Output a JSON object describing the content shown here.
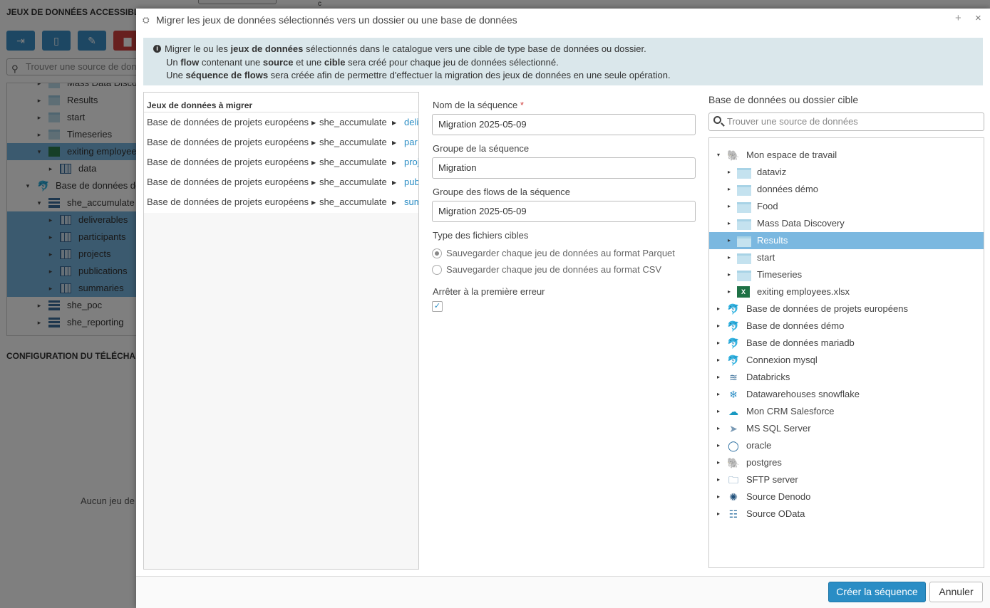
{
  "background": {
    "panel_title": "JEUX DE DONNÉES ACCESSIBLES",
    "search_placeholder": "Trouver une source de donn",
    "tree": [
      {
        "label": "Mass Data Discovery",
        "indent": 1,
        "icon": "folder",
        "selected": false,
        "toggle": "▸"
      },
      {
        "label": "Results",
        "indent": 1,
        "icon": "folder",
        "selected": false,
        "toggle": "▸"
      },
      {
        "label": "start",
        "indent": 1,
        "icon": "folder",
        "selected": false,
        "toggle": "▸"
      },
      {
        "label": "Timeseries",
        "indent": 1,
        "icon": "folder",
        "selected": false,
        "toggle": "▸"
      },
      {
        "label": "exiting employees.x",
        "indent": 1,
        "icon": "xls",
        "selected": true,
        "toggle": "▾"
      },
      {
        "label": "data",
        "indent": 2,
        "icon": "tbl",
        "selected": false,
        "toggle": "▸"
      },
      {
        "label": "Base de données de p",
        "indent": 0,
        "icon": "dolph",
        "selected": false,
        "toggle": "▾"
      },
      {
        "label": "she_accumulate",
        "indent": 1,
        "icon": "db",
        "selected": false,
        "toggle": "▾"
      },
      {
        "label": "deliverables",
        "indent": 2,
        "icon": "tbl",
        "selected": true,
        "toggle": "▸"
      },
      {
        "label": "participants",
        "indent": 2,
        "icon": "tbl",
        "selected": true,
        "toggle": "▸"
      },
      {
        "label": "projects",
        "indent": 2,
        "icon": "tbl",
        "selected": true,
        "toggle": "▸"
      },
      {
        "label": "publications",
        "indent": 2,
        "icon": "tbl",
        "selected": true,
        "toggle": "▸"
      },
      {
        "label": "summaries",
        "indent": 2,
        "icon": "tbl",
        "selected": true,
        "toggle": "▸"
      },
      {
        "label": "she_poc",
        "indent": 1,
        "icon": "db",
        "selected": false,
        "toggle": "▸"
      },
      {
        "label": "she_reporting",
        "indent": 1,
        "icon": "db",
        "selected": false,
        "toggle": "▸"
      }
    ],
    "section_title": "CONFIGURATION DU TÉLÉCHARG",
    "empty_text": "Aucun jeu de",
    "tab2_label": "c"
  },
  "modal": {
    "title": "Migrer les jeux de données sélectionnés vers un dossier ou une base de données",
    "max_glyph": "+",
    "close_glyph": "×",
    "info": {
      "l1_a": "Migrer le ou les ",
      "l1_b": "jeux de données",
      "l1_c": " sélectionnés dans le catalogue vers une cible de type base de données ou dossier.",
      "l2_a": "Un ",
      "l2_b": "flow",
      "l2_c": " contenant une ",
      "l2_d": "source",
      "l2_e": " et une ",
      "l2_f": "cible",
      "l2_g": " sera créé pour chaque jeu de données sélectionné.",
      "l3_a": "Une ",
      "l3_b": "séquence de flows",
      "l3_c": " sera créée afin de permettre d'effectuer la migration des jeux de données en une seule opération."
    },
    "datasets": {
      "header": "Jeux de données à migrer",
      "rows": [
        {
          "db": "Base de données de projets européens",
          "schema": "she_accumulate",
          "table": "deli"
        },
        {
          "db": "Base de données de projets européens",
          "schema": "she_accumulate",
          "table": "par"
        },
        {
          "db": "Base de données de projets européens",
          "schema": "she_accumulate",
          "table": "proj"
        },
        {
          "db": "Base de données de projets européens",
          "schema": "she_accumulate",
          "table": "pub"
        },
        {
          "db": "Base de données de projets européens",
          "schema": "she_accumulate",
          "table": "sum"
        }
      ]
    },
    "form": {
      "seq_name_label": "Nom de la séquence",
      "required_mark": "*",
      "seq_name_value": "Migration 2025-05-09",
      "seq_group_label": "Groupe de la séquence",
      "seq_group_value": "Migration",
      "flows_group_label": "Groupe des flows de la séquence",
      "flows_group_value": "Migration 2025-05-09",
      "file_type_label": "Type des fichiers cibles",
      "radio_parquet": "Sauvegarder chaque jeu de données au format Parquet",
      "radio_csv": "Sauvegarder chaque jeu de données au format CSV",
      "selected_format": "Parquet",
      "stop_label": "Arrêter à la première erreur",
      "stop_checked": true
    },
    "target": {
      "label": "Base de données ou dossier cible",
      "search_placeholder": "Trouver une source de données",
      "tree": [
        {
          "label": "Mon espace de travail",
          "indent": 0,
          "icon": "🐘",
          "name": "workspace-icon",
          "toggle": "▾",
          "selected": false,
          "color": "#5a8fb5"
        },
        {
          "label": "dataviz",
          "indent": 1,
          "icon": "folder",
          "name": "folder-icon",
          "toggle": "▸",
          "selected": false
        },
        {
          "label": "données démo",
          "indent": 1,
          "icon": "folder",
          "name": "folder-icon",
          "toggle": "▸",
          "selected": false
        },
        {
          "label": "Food",
          "indent": 1,
          "icon": "folder",
          "name": "folder-icon",
          "toggle": "▸",
          "selected": false
        },
        {
          "label": "Mass Data Discovery",
          "indent": 1,
          "icon": "folder",
          "name": "folder-icon",
          "toggle": "▸",
          "selected": false
        },
        {
          "label": "Results",
          "indent": 1,
          "icon": "folder",
          "name": "folder-icon",
          "toggle": "▸",
          "selected": true
        },
        {
          "label": "start",
          "indent": 1,
          "icon": "folder",
          "name": "folder-icon",
          "toggle": "▸",
          "selected": false
        },
        {
          "label": "Timeseries",
          "indent": 1,
          "icon": "folder",
          "name": "folder-icon",
          "toggle": "▸",
          "selected": false
        },
        {
          "label": "exiting employees.xlsx",
          "indent": 1,
          "icon": "xls",
          "name": "excel-icon",
          "toggle": "▸",
          "selected": false
        },
        {
          "label": "Base de données de projets européens",
          "indent": 0,
          "icon": "🐬",
          "name": "mysql-dolphin-icon",
          "toggle": "▸",
          "selected": false,
          "color": "#2b6ea3"
        },
        {
          "label": "Base de données démo",
          "indent": 0,
          "icon": "🐬",
          "name": "mysql-dolphin-icon",
          "toggle": "▸",
          "selected": false,
          "color": "#2b6ea3"
        },
        {
          "label": "Base de données mariadb",
          "indent": 0,
          "icon": "🐬",
          "name": "mariadb-icon",
          "toggle": "▸",
          "selected": false,
          "color": "#2b6ea3"
        },
        {
          "label": "Connexion mysql",
          "indent": 0,
          "icon": "🐬",
          "name": "mysql-icon",
          "toggle": "▸",
          "selected": false,
          "color": "#999999"
        },
        {
          "label": "Databricks",
          "indent": 0,
          "icon": "≋",
          "name": "databricks-icon",
          "toggle": "▸",
          "selected": false,
          "color": "#3a6f99"
        },
        {
          "label": "Datawarehouses snowflake",
          "indent": 0,
          "icon": "❄",
          "name": "snowflake-icon",
          "toggle": "▸",
          "selected": false,
          "color": "#2a8dc5"
        },
        {
          "label": "Mon CRM Salesforce",
          "indent": 0,
          "icon": "☁",
          "name": "salesforce-icon",
          "toggle": "▸",
          "selected": false,
          "color": "#1798c1"
        },
        {
          "label": "MS SQL Server",
          "indent": 0,
          "icon": "➤",
          "name": "sql-server-icon",
          "toggle": "▸",
          "selected": false,
          "color": "#7a9ab5"
        },
        {
          "label": "oracle",
          "indent": 0,
          "icon": "◯",
          "name": "oracle-icon",
          "toggle": "▸",
          "selected": false,
          "color": "#2a6ea0"
        },
        {
          "label": "postgres",
          "indent": 0,
          "icon": "🐘",
          "name": "postgres-icon",
          "toggle": "▸",
          "selected": false,
          "color": "#336791"
        },
        {
          "label": "SFTP server",
          "indent": 0,
          "icon": "🗀",
          "name": "sftp-folder-icon",
          "toggle": "▸",
          "selected": false,
          "color": "#3a6f99"
        },
        {
          "label": "Source Denodo",
          "indent": 0,
          "icon": "✺",
          "name": "denodo-icon",
          "toggle": "▸",
          "selected": false,
          "color": "#1f4f7a"
        },
        {
          "label": "Source OData",
          "indent": 0,
          "icon": "☷",
          "name": "odata-icon",
          "toggle": "▸",
          "selected": false,
          "color": "#2a6ea0"
        }
      ]
    },
    "buttons": {
      "create": "Créer la séquence",
      "cancel": "Annuler"
    }
  }
}
